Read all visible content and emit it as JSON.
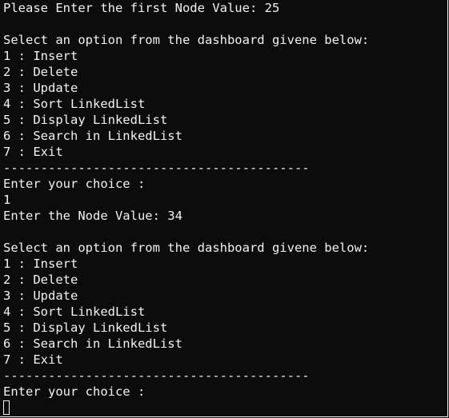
{
  "console": {
    "lines": [
      "Please Enter the first Node Value: 25",
      "",
      "Select an option from the dashboard givene below:",
      "1 : Insert",
      "2 : Delete",
      "3 : Update",
      "4 : Sort LinkedList",
      "5 : Display LinkedList",
      "6 : Search in LinkedList",
      "7 : Exit",
      "-----------------------------------------",
      "Enter your choice :",
      "1",
      "Enter the Node Value: 34",
      "",
      "Select an option from the dashboard givene below:",
      "1 : Insert",
      "2 : Delete",
      "3 : Update",
      "4 : Sort LinkedList",
      "5 : Display LinkedList",
      "6 : Search in LinkedList",
      "7 : Exit",
      "-----------------------------------------",
      "Enter your choice :"
    ],
    "input_value": ""
  }
}
